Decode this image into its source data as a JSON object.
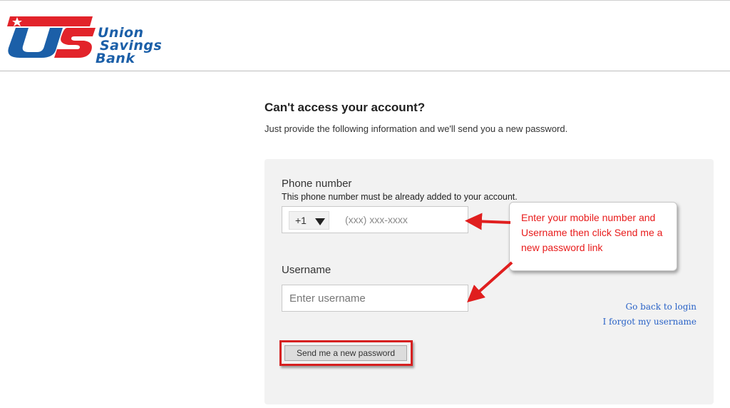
{
  "logo": {
    "mark": "US",
    "line1": "Union",
    "line2": "Savings",
    "line3": "Bank",
    "colors": {
      "red": "#e2232a",
      "blue": "#1b5fa8"
    }
  },
  "page": {
    "title": "Can't access your account?",
    "subtitle": "Just provide the following information and we'll send you a new password."
  },
  "form": {
    "phone_label": "Phone number",
    "phone_hint": "This phone number must be already added to your account.",
    "country_code": "+1",
    "phone_placeholder": "(xxx) xxx-xxxx",
    "username_label": "Username",
    "username_placeholder": "Enter username",
    "submit_label": "Send me a new password"
  },
  "links": {
    "back_to_login": "Go back to login",
    "forgot_username": "I forgot my username"
  },
  "annotation": {
    "text": "Enter your mobile number and Username then click Send me a new password link",
    "color": "#e81b1b"
  },
  "icons": {
    "country_dropdown": "caret-down-icon",
    "arrow": "red-arrow-icon"
  }
}
